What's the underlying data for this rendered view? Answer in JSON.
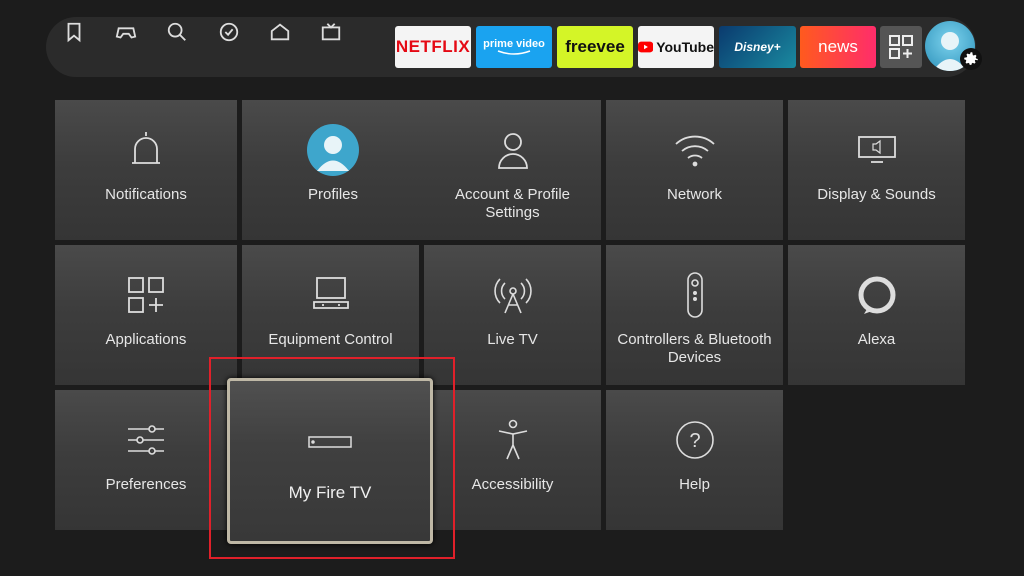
{
  "nav": {
    "icons": [
      "bookmark-icon",
      "gamepad-icon",
      "search-icon",
      "check-circle-icon",
      "home-icon",
      "tv-icon"
    ],
    "apps": {
      "netflix": "NETFLIX",
      "prime_top": "prime video",
      "freevee": "freevee",
      "youtube": "YouTube",
      "disney": "Disney+",
      "news": "news"
    }
  },
  "tiles": {
    "notifications": "Notifications",
    "profiles": "Profiles",
    "account": "Account & Profile Settings",
    "network": "Network",
    "display": "Display & Sounds",
    "applications": "Applications",
    "equipment": "Equipment Control",
    "livetv": "Live TV",
    "controllers": "Controllers & Bluetooth Devices",
    "alexa": "Alexa",
    "preferences": "Preferences",
    "myfiretv": "My Fire TV",
    "accessibility": "Accessibility",
    "help": "Help"
  },
  "colors": {
    "background": "#1c1c1c",
    "highlight": "#e0202a",
    "focus_border": "#bfb8a6"
  }
}
